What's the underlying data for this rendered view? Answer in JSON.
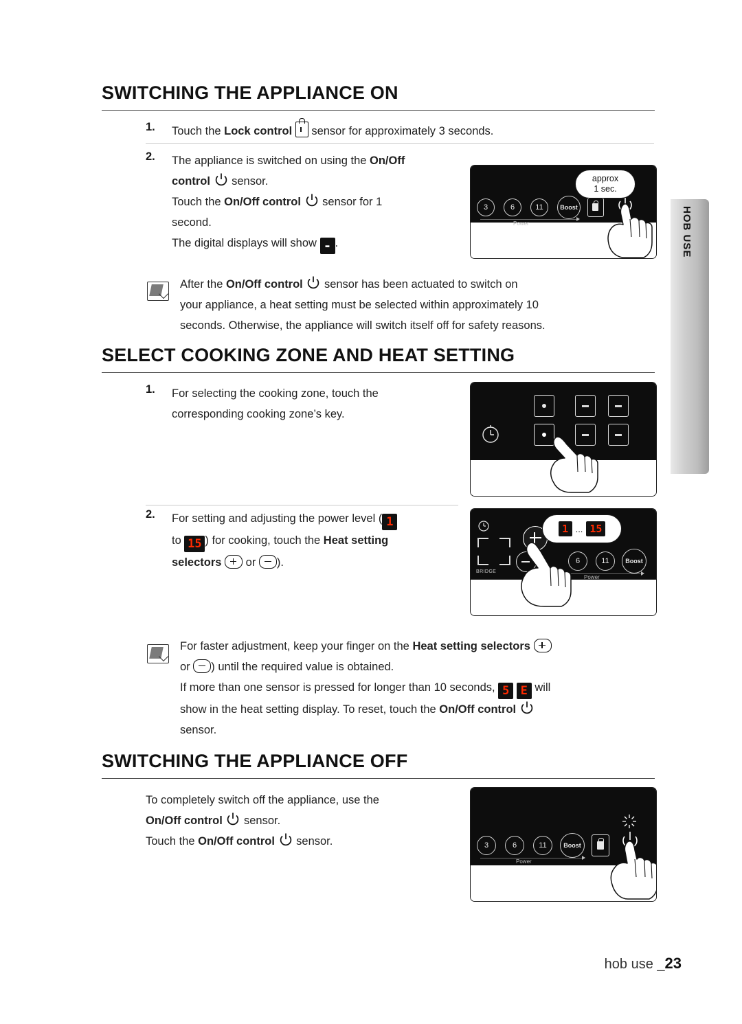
{
  "side_tab": {
    "label": "HOB USE"
  },
  "sections": [
    {
      "heading": "SWITCHING THE APPLIANCE ON",
      "steps": [
        {
          "num": "1.",
          "text_a": "Touch the ",
          "bold_a": "Lock control",
          "icon": "lock-icon",
          "text_b": " sensor for approximately 3 seconds."
        },
        {
          "num": "2.",
          "line1_a": "The appliance is switched on using the ",
          "line1_b": "On/Off",
          "line2_b": "control",
          "line2_a": " sensor.",
          "line3_a": "Touch the ",
          "line3_b": "On/Off control",
          "line3_c": " sensor for 1",
          "line4": "second.",
          "line5_a": "The digital displays will show",
          "line5_seg": "-",
          "line5_b": "."
        }
      ],
      "note": {
        "line1_a": "After the ",
        "line1_b": "On/Off control",
        "line1_c": " sensor has been actuated to switch on",
        "line2": "your appliance, a heat setting must be selected within approximately 10",
        "line3": "seconds. Otherwise, the appliance will switch itself off for safety reasons."
      },
      "illustration": {
        "bubble": [
          "approx",
          "1 sec."
        ],
        "knobs": [
          "3",
          "6",
          "11",
          "Boost"
        ],
        "power_label": "Power"
      }
    },
    {
      "heading": "SELECT COOKING ZONE AND HEAT SETTING",
      "steps": [
        {
          "num": "1.",
          "line1": "For selecting the cooking zone, touch the",
          "line2": "corresponding cooking zone’s key."
        },
        {
          "num": "2.",
          "line1_a": "For setting and adjusting the power level (",
          "seg1": "1",
          "line2_a": "to ",
          "seg2": "15",
          "line2_b": ") for cooking, touch the ",
          "line2_c": "Heat setting",
          "line3_a": "selectors",
          "line3_b": " or ",
          "line3_c": ")."
        }
      ],
      "note": {
        "line1_a": "For faster adjustment, keep your finger on the ",
        "line1_b": "Heat setting selectors",
        "line2_a": "or ",
        "line2_b": ") until the required value is obtained.",
        "line3_a": "If more than one sensor is pressed for longer than 10 seconds, ",
        "line3_seg1": "5",
        "line3_seg2": "E",
        "line3_b": " will",
        "line4_a": "show in the heat setting display. To reset, touch the ",
        "line4_b": "On/Off control",
        "line5": "sensor."
      },
      "illustration_2": {
        "bubble_segments": [
          "1",
          "15"
        ],
        "bubble_dots": "...",
        "bridge_label": "BRIDGE",
        "knobs": [
          "6",
          "11",
          "Boost"
        ],
        "power_label": "Power"
      }
    },
    {
      "heading": "SWITCHING THE APPLIANCE OFF",
      "steps": [
        {
          "line1": "To completely switch off the appliance, use the",
          "line2_b": "On/Off control",
          "line2_a": " sensor.",
          "line3_a": "Touch the ",
          "line3_b": "On/Off control",
          "line3_c": " sensor."
        }
      ],
      "illustration": {
        "knobs": [
          "3",
          "6",
          "11",
          "Boost"
        ],
        "power_label": "Power"
      }
    }
  ],
  "footer": {
    "text": "hob use _",
    "page": "23"
  }
}
